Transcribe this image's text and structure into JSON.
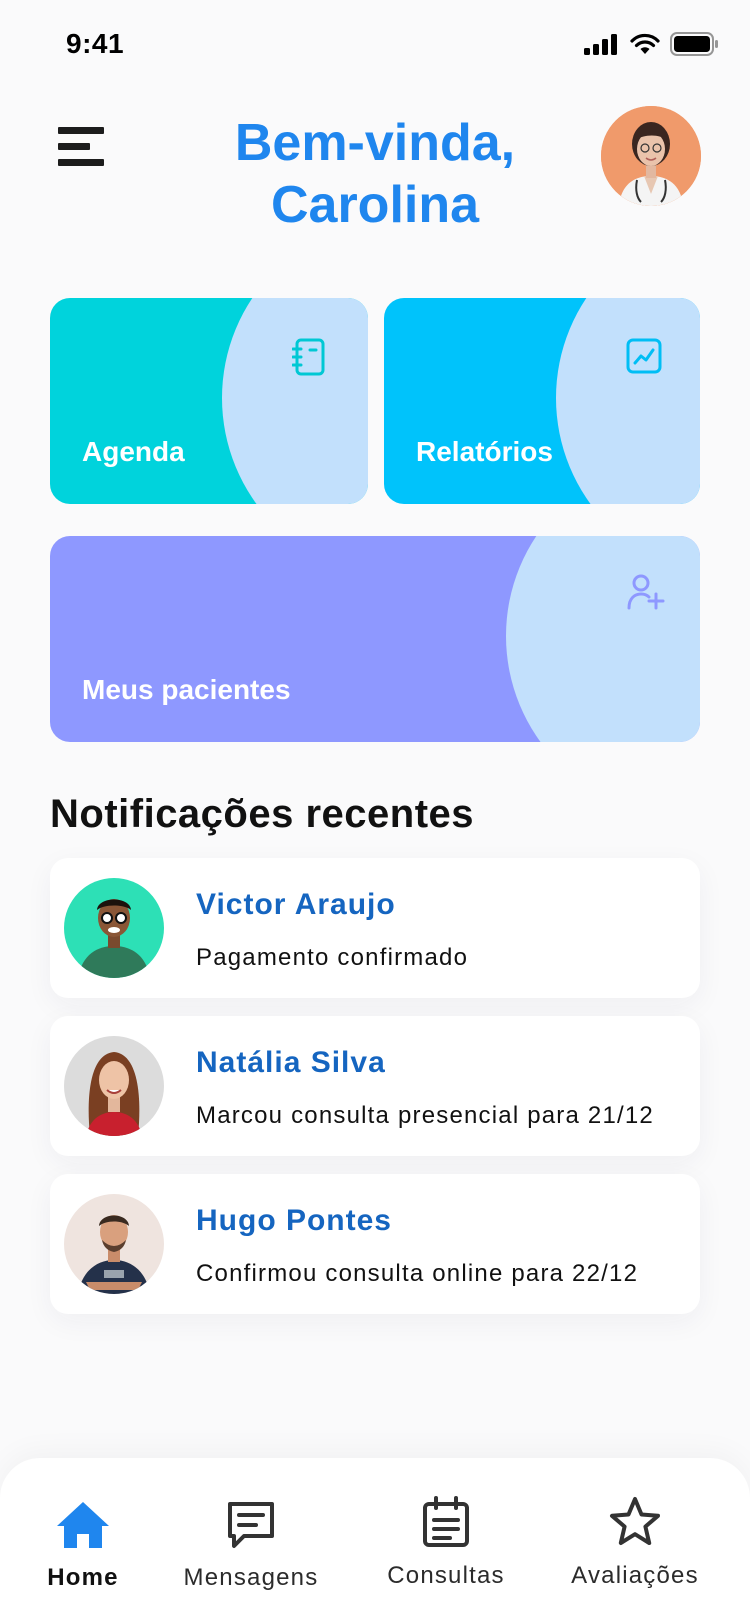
{
  "status_bar": {
    "time": "9:41"
  },
  "header": {
    "greeting_line1": "Bem-vinda,",
    "greeting_line2": "Carolina",
    "accent_color": "#1f86ee"
  },
  "cards": [
    {
      "label": "Agenda",
      "icon": "notebook-icon",
      "color": "#00d3dc"
    },
    {
      "label": "Relatórios",
      "icon": "chart-icon",
      "color": "#00c3fb"
    },
    {
      "label": "Meus pacientes",
      "icon": "add-user-icon",
      "color": "#8e98ff"
    }
  ],
  "notifications": {
    "title": "Notificações recentes",
    "items": [
      {
        "name": "Victor Araujo",
        "message": "Pagamento confirmado",
        "avatar_bg": "#2de0b6"
      },
      {
        "name": "Natália Silva",
        "message": "Marcou consulta presencial para 21/12",
        "avatar_bg": "#dcdcdc"
      },
      {
        "name": "Hugo Pontes",
        "message": "Confirmou consulta online para 22/12",
        "avatar_bg": "#efe4df"
      }
    ]
  },
  "bottom_nav": {
    "active_color": "#1f86ee",
    "items": [
      {
        "label": "Home",
        "icon": "home-icon",
        "active": true
      },
      {
        "label": "Mensagens",
        "icon": "message-icon",
        "active": false
      },
      {
        "label": "Consultas",
        "icon": "calendar-icon",
        "active": false
      },
      {
        "label": "Avaliações",
        "icon": "star-icon",
        "active": false
      }
    ]
  }
}
